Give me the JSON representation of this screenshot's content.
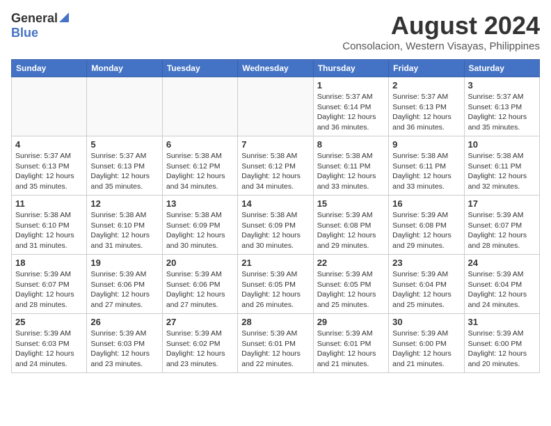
{
  "header": {
    "logo_general": "General",
    "logo_blue": "Blue",
    "month_year": "August 2024",
    "location": "Consolacion, Western Visayas, Philippines"
  },
  "days_of_week": [
    "Sunday",
    "Monday",
    "Tuesday",
    "Wednesday",
    "Thursday",
    "Friday",
    "Saturday"
  ],
  "weeks": [
    [
      {
        "day": "",
        "info": ""
      },
      {
        "day": "",
        "info": ""
      },
      {
        "day": "",
        "info": ""
      },
      {
        "day": "",
        "info": ""
      },
      {
        "day": "1",
        "info": "Sunrise: 5:37 AM\nSunset: 6:14 PM\nDaylight: 12 hours\nand 36 minutes."
      },
      {
        "day": "2",
        "info": "Sunrise: 5:37 AM\nSunset: 6:13 PM\nDaylight: 12 hours\nand 36 minutes."
      },
      {
        "day": "3",
        "info": "Sunrise: 5:37 AM\nSunset: 6:13 PM\nDaylight: 12 hours\nand 35 minutes."
      }
    ],
    [
      {
        "day": "4",
        "info": "Sunrise: 5:37 AM\nSunset: 6:13 PM\nDaylight: 12 hours\nand 35 minutes."
      },
      {
        "day": "5",
        "info": "Sunrise: 5:37 AM\nSunset: 6:13 PM\nDaylight: 12 hours\nand 35 minutes."
      },
      {
        "day": "6",
        "info": "Sunrise: 5:38 AM\nSunset: 6:12 PM\nDaylight: 12 hours\nand 34 minutes."
      },
      {
        "day": "7",
        "info": "Sunrise: 5:38 AM\nSunset: 6:12 PM\nDaylight: 12 hours\nand 34 minutes."
      },
      {
        "day": "8",
        "info": "Sunrise: 5:38 AM\nSunset: 6:11 PM\nDaylight: 12 hours\nand 33 minutes."
      },
      {
        "day": "9",
        "info": "Sunrise: 5:38 AM\nSunset: 6:11 PM\nDaylight: 12 hours\nand 33 minutes."
      },
      {
        "day": "10",
        "info": "Sunrise: 5:38 AM\nSunset: 6:11 PM\nDaylight: 12 hours\nand 32 minutes."
      }
    ],
    [
      {
        "day": "11",
        "info": "Sunrise: 5:38 AM\nSunset: 6:10 PM\nDaylight: 12 hours\nand 31 minutes."
      },
      {
        "day": "12",
        "info": "Sunrise: 5:38 AM\nSunset: 6:10 PM\nDaylight: 12 hours\nand 31 minutes."
      },
      {
        "day": "13",
        "info": "Sunrise: 5:38 AM\nSunset: 6:09 PM\nDaylight: 12 hours\nand 30 minutes."
      },
      {
        "day": "14",
        "info": "Sunrise: 5:38 AM\nSunset: 6:09 PM\nDaylight: 12 hours\nand 30 minutes."
      },
      {
        "day": "15",
        "info": "Sunrise: 5:39 AM\nSunset: 6:08 PM\nDaylight: 12 hours\nand 29 minutes."
      },
      {
        "day": "16",
        "info": "Sunrise: 5:39 AM\nSunset: 6:08 PM\nDaylight: 12 hours\nand 29 minutes."
      },
      {
        "day": "17",
        "info": "Sunrise: 5:39 AM\nSunset: 6:07 PM\nDaylight: 12 hours\nand 28 minutes."
      }
    ],
    [
      {
        "day": "18",
        "info": "Sunrise: 5:39 AM\nSunset: 6:07 PM\nDaylight: 12 hours\nand 28 minutes."
      },
      {
        "day": "19",
        "info": "Sunrise: 5:39 AM\nSunset: 6:06 PM\nDaylight: 12 hours\nand 27 minutes."
      },
      {
        "day": "20",
        "info": "Sunrise: 5:39 AM\nSunset: 6:06 PM\nDaylight: 12 hours\nand 27 minutes."
      },
      {
        "day": "21",
        "info": "Sunrise: 5:39 AM\nSunset: 6:05 PM\nDaylight: 12 hours\nand 26 minutes."
      },
      {
        "day": "22",
        "info": "Sunrise: 5:39 AM\nSunset: 6:05 PM\nDaylight: 12 hours\nand 25 minutes."
      },
      {
        "day": "23",
        "info": "Sunrise: 5:39 AM\nSunset: 6:04 PM\nDaylight: 12 hours\nand 25 minutes."
      },
      {
        "day": "24",
        "info": "Sunrise: 5:39 AM\nSunset: 6:04 PM\nDaylight: 12 hours\nand 24 minutes."
      }
    ],
    [
      {
        "day": "25",
        "info": "Sunrise: 5:39 AM\nSunset: 6:03 PM\nDaylight: 12 hours\nand 24 minutes."
      },
      {
        "day": "26",
        "info": "Sunrise: 5:39 AM\nSunset: 6:03 PM\nDaylight: 12 hours\nand 23 minutes."
      },
      {
        "day": "27",
        "info": "Sunrise: 5:39 AM\nSunset: 6:02 PM\nDaylight: 12 hours\nand 23 minutes."
      },
      {
        "day": "28",
        "info": "Sunrise: 5:39 AM\nSunset: 6:01 PM\nDaylight: 12 hours\nand 22 minutes."
      },
      {
        "day": "29",
        "info": "Sunrise: 5:39 AM\nSunset: 6:01 PM\nDaylight: 12 hours\nand 21 minutes."
      },
      {
        "day": "30",
        "info": "Sunrise: 5:39 AM\nSunset: 6:00 PM\nDaylight: 12 hours\nand 21 minutes."
      },
      {
        "day": "31",
        "info": "Sunrise: 5:39 AM\nSunset: 6:00 PM\nDaylight: 12 hours\nand 20 minutes."
      }
    ]
  ]
}
